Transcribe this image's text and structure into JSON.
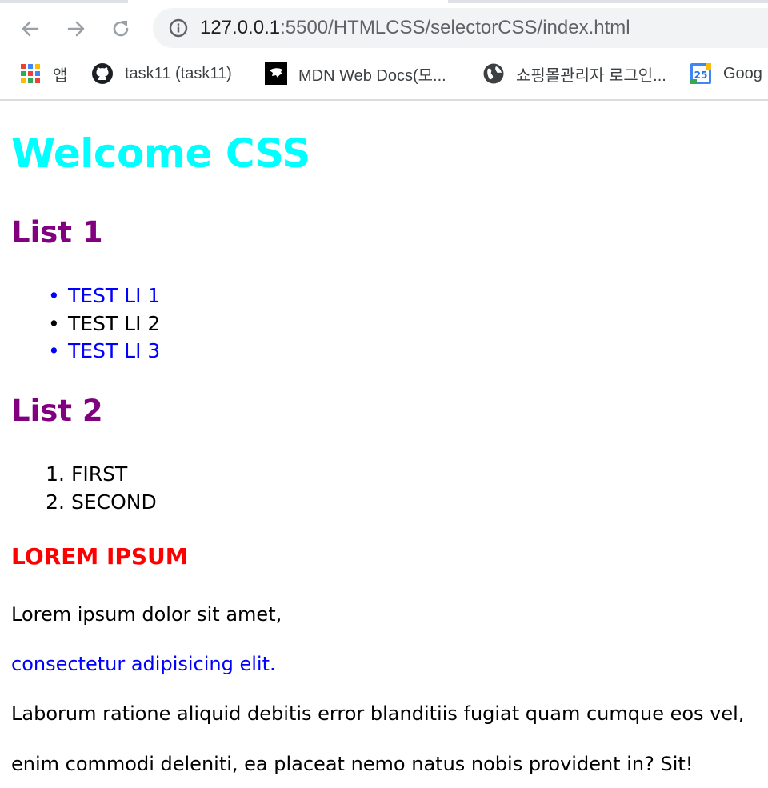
{
  "browser": {
    "url_host": "127.0.0.1",
    "url_rest": ":5500/HTMLCSS/selectorCSS/index.html",
    "bookmarks": [
      {
        "label": "앱",
        "icon": "apps-grid-icon"
      },
      {
        "label": "task11 (task11)",
        "icon": "github-icon"
      },
      {
        "label": "MDN Web Docs(모...",
        "icon": "mdn-icon"
      },
      {
        "label": "쇼핑몰관리자 로그인...",
        "icon": "globe-icon"
      },
      {
        "label": "Goog",
        "icon": "google-calendar-icon",
        "badge": "25"
      }
    ]
  },
  "page": {
    "title": "Welcome CSS",
    "list1": {
      "heading": "List 1",
      "items": [
        {
          "text": "TEST LI 1",
          "color": "#0000ff"
        },
        {
          "text": "TEST LI 2",
          "color": "#000000"
        },
        {
          "text": "TEST LI 3",
          "color": "#0000ff"
        }
      ]
    },
    "list2": {
      "heading": "List 2",
      "items": [
        {
          "marker": "1.",
          "text": "FIRST"
        },
        {
          "marker": "2.",
          "text": "SECOND"
        }
      ]
    },
    "section_heading": "LOREM IPSUM",
    "paragraphs": [
      {
        "text": "Lorem ipsum dolor sit amet,",
        "color": "#000000"
      },
      {
        "text": "consectetur adipisicing elit.",
        "color": "#0000ff"
      },
      {
        "text": "Laborum ratione aliquid debitis error blanditiis fugiat quam cumque eos vel,",
        "color": "#000000"
      },
      {
        "text": "enim commodi deleniti, ea placeat nemo natus nobis provident in? Sit!",
        "color": "#000000"
      }
    ]
  },
  "colors": {
    "title": "#00ffff",
    "heading": "#800080",
    "section": "#ff0000",
    "link_blue": "#0000ff"
  }
}
